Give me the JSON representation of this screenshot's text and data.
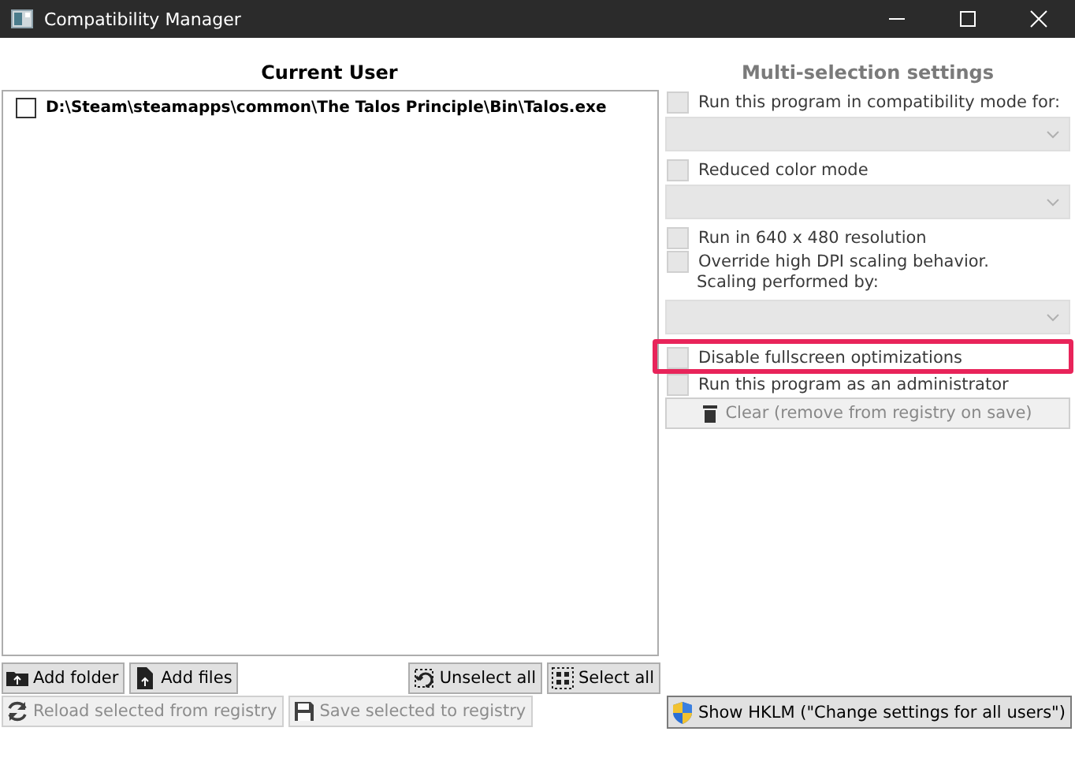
{
  "window": {
    "title": "Compatibility Manager"
  },
  "current_user": {
    "heading": "Current User",
    "items": [
      {
        "label": "D:\\Steam\\steamapps\\common\\The Talos Principle\\Bin\\Talos.exe",
        "checked": false
      }
    ]
  },
  "settings": {
    "heading": "Multi-selection settings",
    "disabled": true,
    "options": [
      {
        "kind": "checkbox",
        "label": "Run this program in compatibility mode for:",
        "checked": false,
        "highlighted": false
      },
      {
        "kind": "dropdown"
      },
      {
        "kind": "checkbox",
        "label": "Reduced color mode",
        "checked": false,
        "highlighted": false
      },
      {
        "kind": "dropdown"
      },
      {
        "kind": "checkbox",
        "label": "Run in 640 x 480 resolution",
        "checked": false,
        "highlighted": false
      },
      {
        "kind": "checkbox",
        "label": "Override high DPI scaling behavior.",
        "checked": false,
        "highlighted": false
      },
      {
        "kind": "label",
        "label": "Scaling performed by:"
      },
      {
        "kind": "dropdown"
      },
      {
        "kind": "checkbox",
        "label": "Disable fullscreen optimizations",
        "checked": false,
        "highlighted": true
      },
      {
        "kind": "checkbox",
        "label": "Run this program as an administrator",
        "checked": false,
        "highlighted": false
      }
    ],
    "clear_button": {
      "label": "Clear (remove from registry on save)",
      "disabled": true
    }
  },
  "list_buttons": [
    {
      "kind": "add-folder",
      "label": "Add folder",
      "disabled": false
    },
    {
      "kind": "add-files",
      "label": "Add files",
      "disabled": false
    },
    {
      "kind": "unselect",
      "label": "Unselect all",
      "disabled": false
    },
    {
      "kind": "select",
      "label": "Select all",
      "disabled": false
    }
  ],
  "registry_buttons": [
    {
      "kind": "reload",
      "label": "Reload selected from registry",
      "disabled": true
    },
    {
      "kind": "save",
      "label": "Save selected to registry",
      "disabled": true
    },
    {
      "kind": "shield",
      "label": "Show HKLM (\"Change settings for all users\")",
      "disabled": false
    }
  ]
}
